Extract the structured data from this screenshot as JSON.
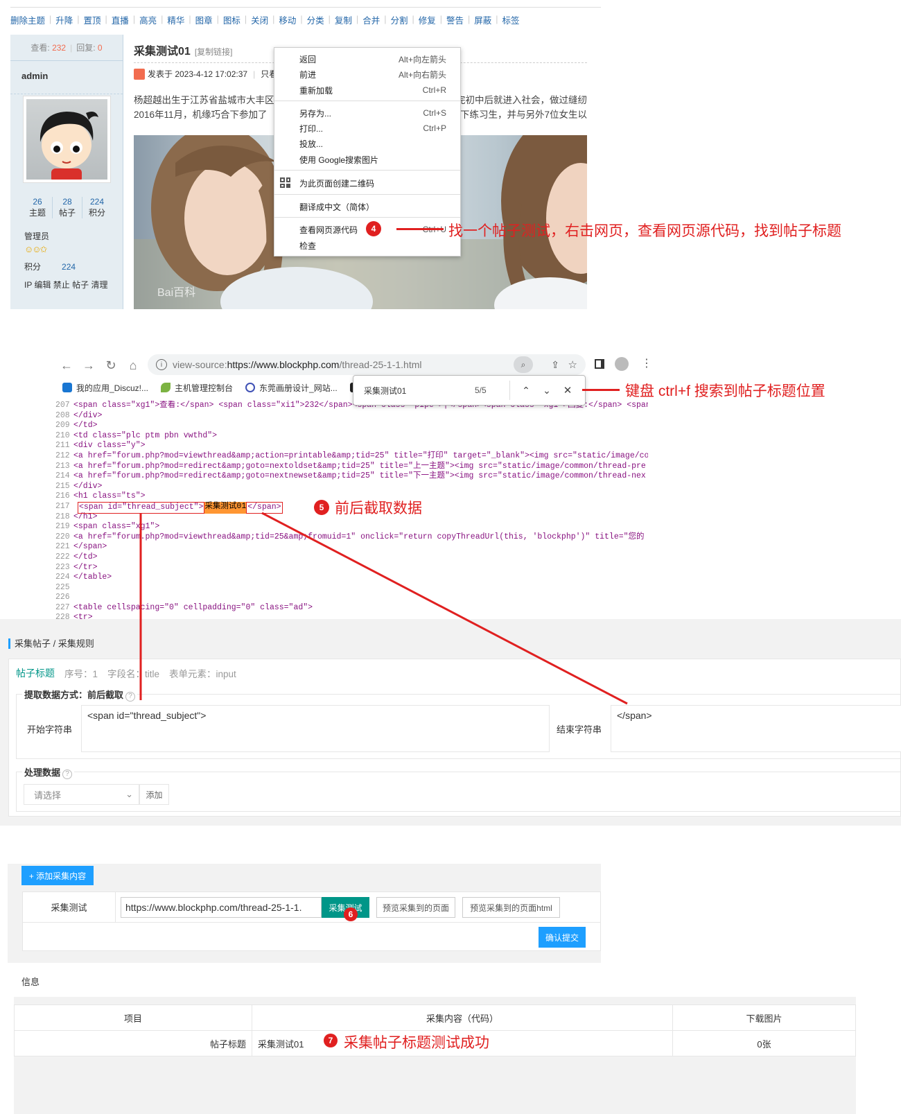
{
  "section1": {
    "toolbar": [
      "删除主题",
      "升降",
      "置顶",
      "直播",
      "高亮",
      "精华",
      "图章",
      "图标",
      "关闭",
      "移动",
      "分类",
      "复制",
      "合并",
      "分割",
      "修复",
      "警告",
      "屏蔽",
      "标签"
    ],
    "views_label": "查看:",
    "views": "232",
    "replies_label": "回复:",
    "replies": "0",
    "username": "admin",
    "user_stats": [
      {
        "value": "26",
        "label": "主题"
      },
      {
        "value": "28",
        "label": "帖子"
      },
      {
        "value": "224",
        "label": "积分"
      }
    ],
    "role": "管理员",
    "smileys": "☺☺✩",
    "points_label": "积分",
    "points": "224",
    "ops": "IP 编辑 禁止 帖子 清理",
    "post_title": "采集测试01",
    "copy_link": "[复制链接]",
    "post_meta": "发表于 2023-4-12 17:02:37",
    "post_meta_extra": "只看",
    "body_line1": "杨超越出生于江苏省盐城市大丰区",
    "body_line1_tail": "完初中后就进入社会，做过缝纫",
    "body_line2": "2016年11月，机缘巧合下参加了",
    "body_line2_tail": "下练习生，并与另外7位女生以",
    "watermark": "Bai百科",
    "context_menu": [
      {
        "label": "返回",
        "shortcut": "Alt+向左箭头"
      },
      {
        "label": "前进",
        "shortcut": "Alt+向右箭头"
      },
      {
        "label": "重新加载",
        "shortcut": "Ctrl+R"
      },
      {
        "label": "另存为...",
        "shortcut": "Ctrl+S"
      },
      {
        "label": "打印...",
        "shortcut": "Ctrl+P"
      },
      {
        "label": "投放...",
        "shortcut": ""
      },
      {
        "label": "使用 Google搜索图片",
        "shortcut": ""
      },
      {
        "label": "为此页面创建二维码",
        "shortcut": ""
      },
      {
        "label": "翻译成中文（简体）",
        "shortcut": ""
      },
      {
        "label": "查看网页源代码",
        "shortcut": "Ctrl+U"
      },
      {
        "label": "检查",
        "shortcut": ""
      }
    ],
    "step4_num": "4",
    "step4_text": "找一个帖子测试，右击网页，查看网页源代码，找到帖子标题"
  },
  "section2": {
    "url_scheme": "view-source:",
    "url_host": "https://www.blockphp.com",
    "url_path": "/thread-25-1-1.html",
    "bookmarks": [
      "我的应用_Discuz!...",
      "主机管理控制台",
      "东莞画册设计_网站..."
    ],
    "find_query": "采集测试01",
    "find_count": "5/5",
    "step_find_text": "键盘 ctrl+f  搜索到帖子标题位置",
    "source_lines": [
      {
        "n": "207",
        "t": "<span class=\"xg1\">查看:</span> <span class=\"xi1\">232</span><span class=\"pipe\">|</span><span class=\"xg1\">回复:</span> <span"
      },
      {
        "n": "208",
        "t": "</div>"
      },
      {
        "n": "209",
        "t": "</td>"
      },
      {
        "n": "210",
        "t": "<td class=\"plc ptm pbn vwthd\">"
      },
      {
        "n": "211",
        "t": "<div class=\"y\">"
      },
      {
        "n": "212",
        "t": "<a href=\"forum.php?mod=viewthread&amp;action=printable&amp;tid=25\" title=\"打印\" target=\"_blank\"><img src=\"static/image/co"
      },
      {
        "n": "213",
        "t": "<a href=\"forum.php?mod=redirect&amp;goto=nextoldset&amp;tid=25\" title=\"上一主题\"><img src=\"static/image/common/thread-pre"
      },
      {
        "n": "214",
        "t": "<a href=\"forum.php?mod=redirect&amp;goto=nextnewset&amp;tid=25\" title=\"下一主题\"><img src=\"static/image/common/thread-nex"
      },
      {
        "n": "215",
        "t": "</div>"
      },
      {
        "n": "216",
        "t": "<h1 class=\"ts\">"
      },
      {
        "n": "217",
        "t": ""
      },
      {
        "n": "218",
        "t": "</h1>"
      },
      {
        "n": "219",
        "t": "<span class=\"xg1\">"
      },
      {
        "n": "220",
        "t": "<a href=\"forum.php?mod=viewthread&amp;tid=25&amp;fromuid=1\" onclick=\"return copyThreadUrl(this, 'blockphp')\" title=\"您的"
      },
      {
        "n": "221",
        "t": "</span>"
      },
      {
        "n": "222",
        "t": "</td>"
      },
      {
        "n": "223",
        "t": "</tr>"
      },
      {
        "n": "224",
        "t": "</table>"
      },
      {
        "n": "225",
        "t": ""
      },
      {
        "n": "226",
        "t": ""
      },
      {
        "n": "227",
        "t": "<table cellspacing=\"0\" cellpadding=\"0\" class=\"ad\">"
      },
      {
        "n": "228",
        "t": "<tr>"
      }
    ],
    "hl_open": "<span id=\"thread_subject\">",
    "hl_text": "采集测试01",
    "hl_close": "</span>",
    "step5_num": "5",
    "step5_text": "前后截取数据"
  },
  "section3": {
    "breadcrumb": "采集帖子 / 采集规则",
    "field_name": "帖子标题",
    "field_meta": [
      "序号：1",
      "字段名：title",
      "表单元素：input"
    ],
    "extract_legend": "提取数据方式：前后截取",
    "start_label": "开始字符串",
    "start_value": "<span id=\"thread_subject\">",
    "end_label": "结束字符串",
    "end_value": "</span>",
    "process_legend": "处理数据",
    "select_placeholder": "请选择",
    "add_label": "添加"
  },
  "section4": {
    "add_content": "+ 添加采集内容",
    "test_label": "采集测试",
    "test_url": "https://www.blockphp.com/thread-25-1-1.",
    "test_button": "采集测试",
    "preview_page": "预览采集到的页面",
    "preview_html": "预览采集到的页面html",
    "submit": "确认提交",
    "step6_num": "6"
  },
  "section5": {
    "info": "信息",
    "headers": [
      "项目",
      "采集内容（代码）",
      "下载图片"
    ],
    "row": {
      "item": "帖子标题",
      "content": "采集测试01",
      "images": "0张"
    },
    "step7_num": "7",
    "step7_text": "采集帖子标题测试成功"
  },
  "colors": {
    "accent": "#1e9fff",
    "teal": "#009688",
    "annotation": "#e02020",
    "link": "#2366a8"
  }
}
